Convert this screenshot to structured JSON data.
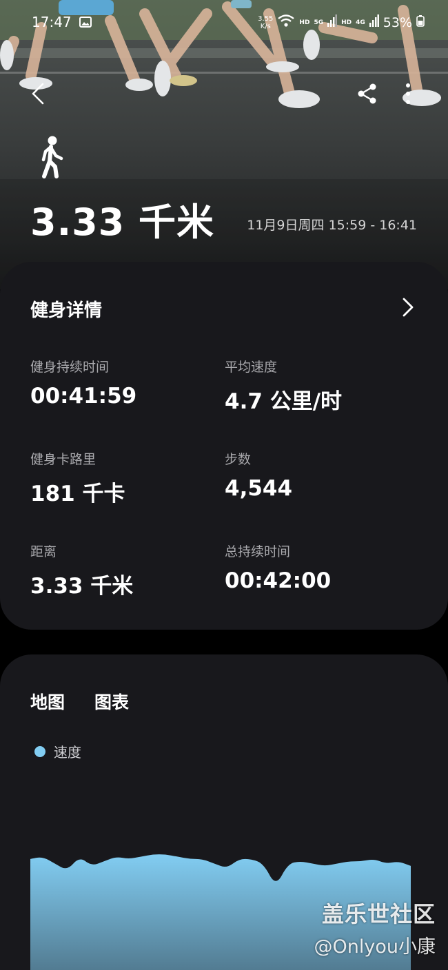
{
  "status_bar": {
    "time": "17:47",
    "net_speed_top": "3.55",
    "net_speed_bottom": "K/s",
    "hd1": "HD",
    "five_g": "5G",
    "hd2": "HD",
    "four_g": "4G",
    "battery": "53%"
  },
  "header": {
    "distance": "3.33 千米",
    "date_range": "11月9日周四 15:59 - 16:41"
  },
  "details": {
    "title": "健身详情",
    "stats": [
      {
        "label": "健身持续时间",
        "value": "00:41:59"
      },
      {
        "label": "平均速度",
        "value": "4.7 公里/时"
      },
      {
        "label": "健身卡路里",
        "value": "181 千卡"
      },
      {
        "label": "步数",
        "value": "4,544"
      },
      {
        "label": "距离",
        "value": "3.33 千米"
      },
      {
        "label": "总持续时间",
        "value": "00:42:00"
      }
    ]
  },
  "chart_card": {
    "tab_map": "地图",
    "tab_chart": "图表",
    "legend_label": "速度",
    "series_color": "#82cdf2"
  },
  "chart_data": {
    "type": "area",
    "title": "",
    "xlabel": "",
    "ylabel": "",
    "series": [
      {
        "name": "速度",
        "values": [
          4.8,
          4.9,
          4.6,
          4.3,
          4.9,
          4.5,
          4.7,
          4.9,
          4.8,
          4.9,
          5.0,
          5.0,
          4.9,
          4.8,
          4.8,
          4.6,
          4.4,
          4.8,
          4.8,
          4.6,
          3.6,
          4.6,
          4.7,
          4.6,
          4.5,
          4.6,
          4.7,
          4.7,
          4.8,
          4.6,
          4.7,
          4.5
        ]
      }
    ]
  },
  "watermark": {
    "line1": "盖乐世社区",
    "line2": "@Onlyou小康"
  },
  "colors": {
    "card_bg": "#18181c",
    "accent": "#82cdf2"
  }
}
